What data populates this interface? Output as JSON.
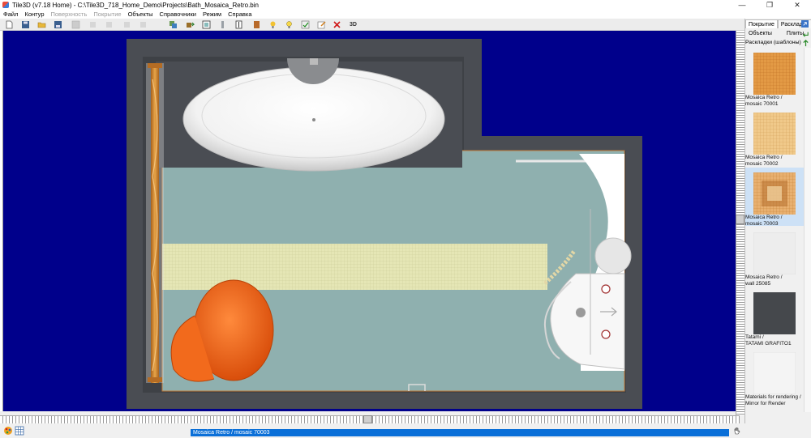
{
  "window": {
    "title": "Tile3D (v7.18 Home) - C:\\Tile3D_718_Home_Demo\\Projects\\Bath_Mosaica_Retro.bin",
    "min_glyph": "—",
    "max_glyph": "❐",
    "close_glyph": "✕"
  },
  "menu": {
    "items": [
      {
        "label": "Файл",
        "enabled": true
      },
      {
        "label": "Контур",
        "enabled": true
      },
      {
        "label": "Поверхность",
        "enabled": false
      },
      {
        "label": "Покрытие",
        "enabled": false
      },
      {
        "label": "Объекты",
        "enabled": true
      },
      {
        "label": "Справочники",
        "enabled": true
      },
      {
        "label": "Режим",
        "enabled": true
      },
      {
        "label": "Справка",
        "enabled": true
      }
    ]
  },
  "toolbar": {
    "label_3d": "3D"
  },
  "right_panel": {
    "tabs": [
      "Покрытие",
      "Раскладки"
    ],
    "subtabs": [
      "Объекты",
      "Плиты"
    ],
    "header": "Раскладки (шаблоны)",
    "materials": [
      {
        "line1": "Mosaica Retro /",
        "line2": "mosaic 70001",
        "pattern": "mosaic-orange"
      },
      {
        "line1": "Mosaica Retro /",
        "line2": "mosaic 70002",
        "pattern": "mosaic-light"
      },
      {
        "line1": "Mosaica Retro /",
        "line2": "mosaic 70003",
        "pattern": "mosaic-center"
      },
      {
        "line1": "Mosaica Retro /",
        "line2": "wall 25085",
        "pattern": "plain-white"
      },
      {
        "line1": "Tatami /",
        "line2": "TATAMI GRAFITO1",
        "pattern": "plain-graphite"
      },
      {
        "line1": "Materials for rendering /",
        "line2": "Mirror for Render",
        "pattern": "plain-light"
      }
    ],
    "selected_index": 2
  },
  "status": {
    "current_material": "Mosaica Retro / mosaic 70003"
  },
  "colors": {
    "canvas_bg": "#00008b",
    "wall": "#4a4d53",
    "floor": "#8fb0af",
    "mosaic_band": "#e5e6b5",
    "accent_orange": "#f26a1c",
    "status_blue": "#0a6fd8"
  }
}
